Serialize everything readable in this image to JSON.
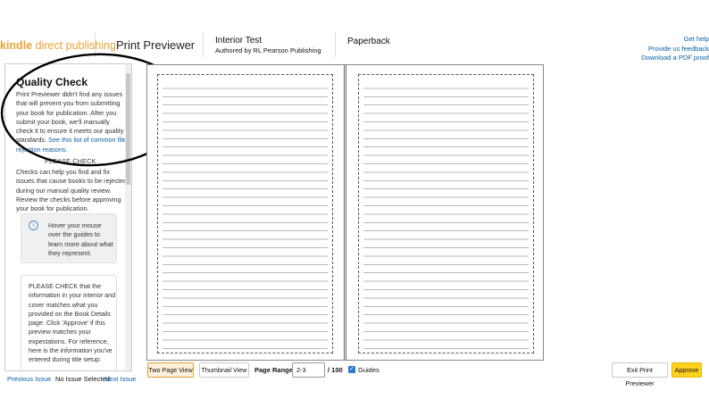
{
  "header": {
    "brand_kindle": "kindle",
    "brand_rest": " direct publishing",
    "section": "Print Previewer",
    "book_title": "Interior Test",
    "book_author": "Authored by RL Pearson Publishing",
    "format": "Paperback",
    "links": [
      "Get help",
      "Provide us feedback",
      "Download a PDF proof"
    ]
  },
  "left_panel": {
    "title": "Quality Check",
    "intro": "Print Previewer didn't find any issues that will prevent you from submitting your book for publication. After you submit your book, we'll manually check it to ensure it meets our quality standards. ",
    "intro_link": "See this list of common file rejection reasons.",
    "check_label": "PLEASE CHECK",
    "checks_text": "Checks can help you find and fix issues that cause books to be rejected during our manual quality review. Review the checks before approving your book for publication.",
    "info_icon": "i",
    "hover_text": "Hover your mouse over the guides to learn more about what they represent.",
    "please_text": "PLEASE CHECK that the information in your interior and cover matches what you provided on the Book Details page. Click 'Approve' if this preview matches your expectations. For reference, here is the information you've entered during title setup:"
  },
  "bottom": {
    "previous": "Previous Issue",
    "no_issue": "No Issue Selected",
    "next": "Next Issue",
    "two_page": "Two Page View",
    "thumbnail": "Thumbnail View",
    "range_label": "Page Range:",
    "range_value": "2-3",
    "range_total": "/ 100",
    "guides_checked": "✓",
    "guides_label": "Guides",
    "exit": "Exit Print Previewer",
    "approve": "Approve"
  },
  "colors": {
    "brand": "#e7a33a",
    "link": "#0b5fa5",
    "approve": "#ffd21e",
    "annotation": "#000000"
  }
}
